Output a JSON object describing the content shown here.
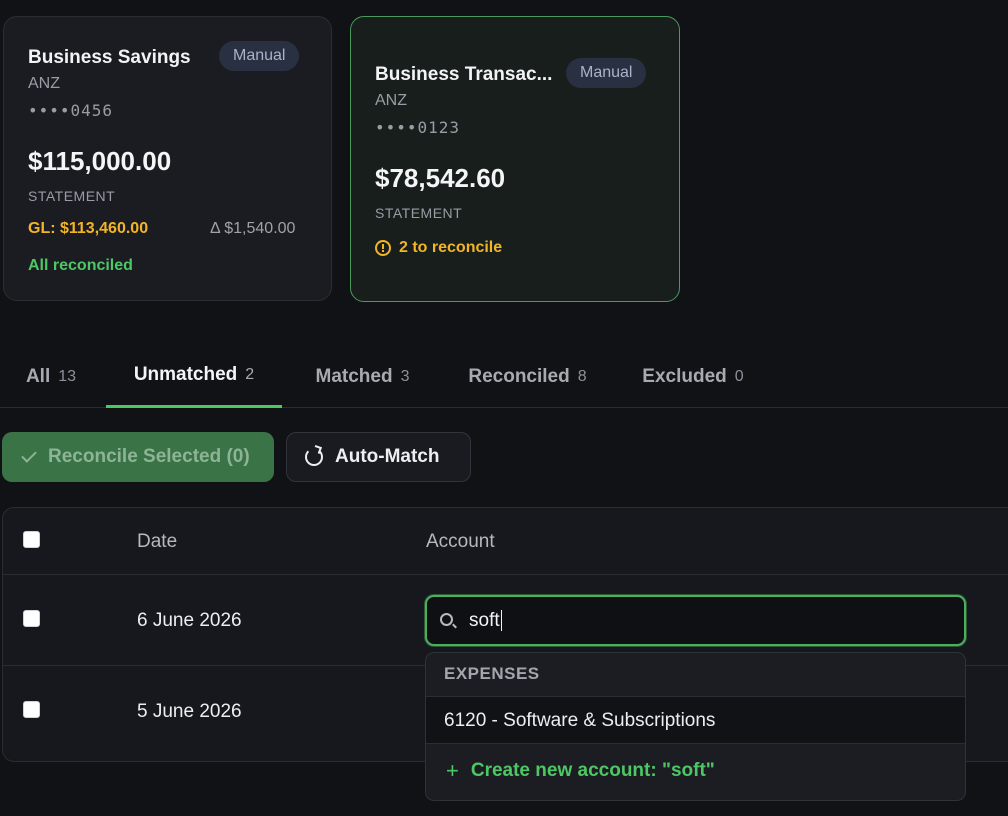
{
  "accounts": [
    {
      "name": "Business Savings",
      "badge": "Manual",
      "bank": "ANZ",
      "mask": "••••0456",
      "balance": "$115,000.00",
      "balance_label": "STATEMENT",
      "gl": "GL: $113,460.00",
      "delta": "Δ $1,540.00",
      "status": "All reconciled"
    },
    {
      "name": "Business Transac...",
      "badge": "Manual",
      "bank": "ANZ",
      "mask": "••••0123",
      "balance": "$78,542.60",
      "balance_label": "STATEMENT",
      "status": "2 to reconcile",
      "status_icon": "clock-icon"
    }
  ],
  "tabs": [
    {
      "label": "All",
      "count": "13"
    },
    {
      "label": "Unmatched",
      "count": "2",
      "active": true
    },
    {
      "label": "Matched",
      "count": "3"
    },
    {
      "label": "Reconciled",
      "count": "8"
    },
    {
      "label": "Excluded",
      "count": "0"
    }
  ],
  "actions": {
    "reconcile_label": "Reconcile Selected (0)",
    "automatch_label": "Auto-Match"
  },
  "table": {
    "headers": {
      "date": "Date",
      "account": "Account"
    },
    "rows": [
      {
        "date": "6 June 2026"
      },
      {
        "date": "5 June 2026"
      }
    ]
  },
  "account_search": {
    "value": "soft",
    "group": "EXPENSES",
    "option": "6120 - Software & Subscriptions",
    "create_label": "Create new account: \"soft\""
  },
  "colors": {
    "accent_green": "#4cc764",
    "warning_amber": "#f1b526",
    "badge_bg": "#283042"
  }
}
